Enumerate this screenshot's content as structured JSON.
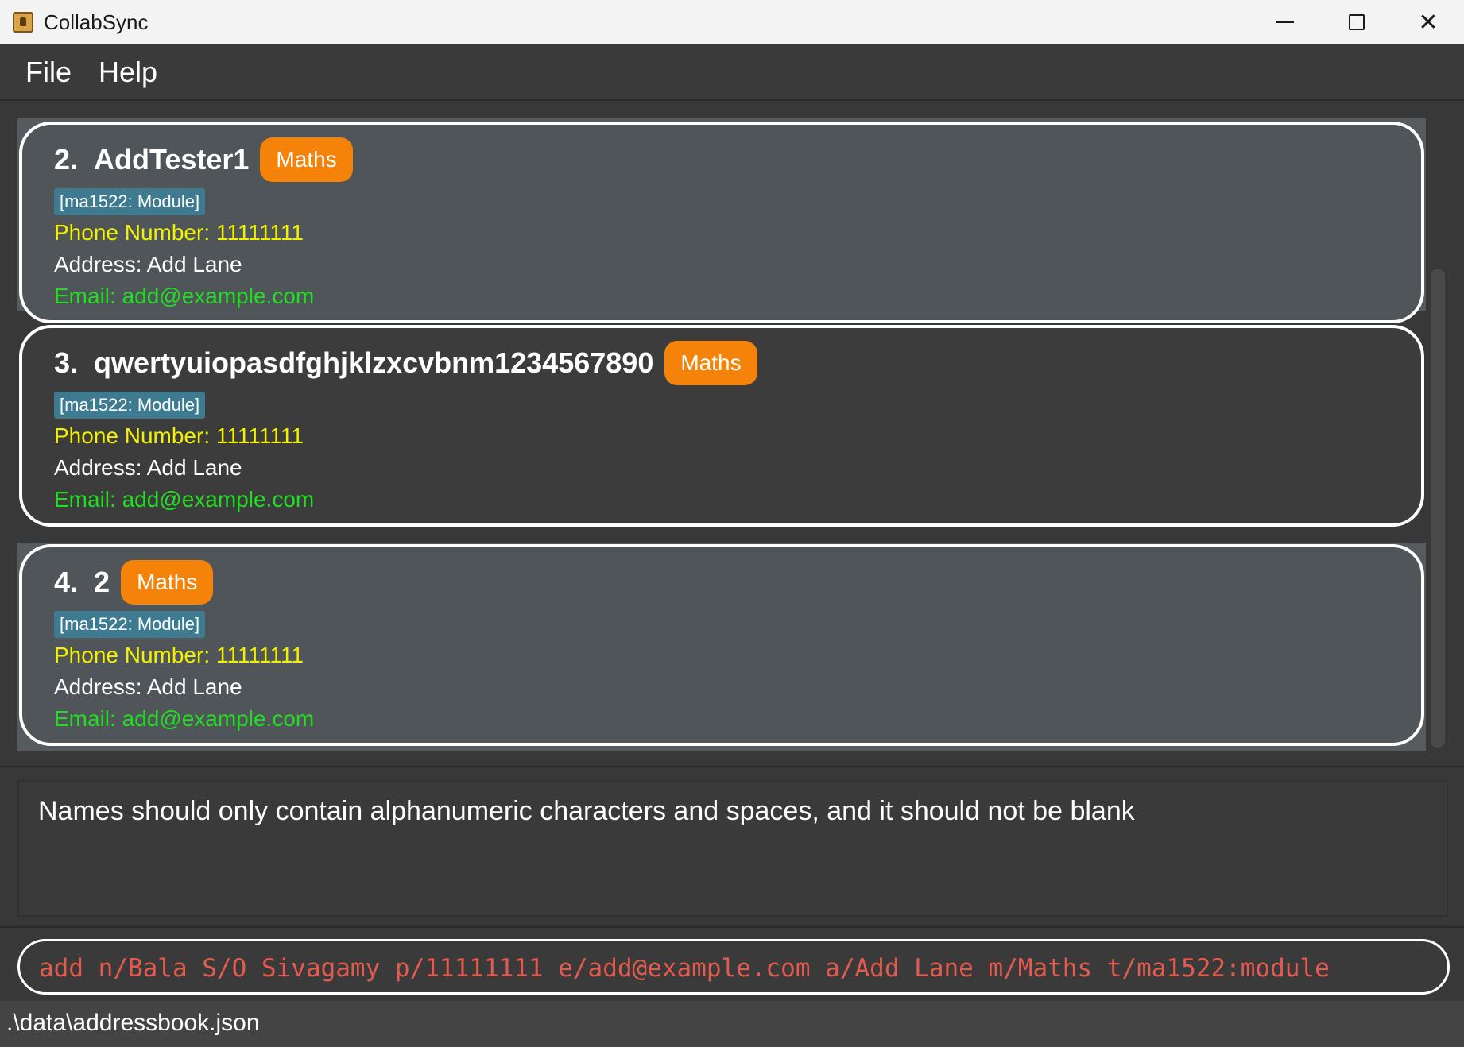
{
  "window": {
    "title": "CollabSync",
    "minimize_glyph": "",
    "close_glyph": "✕"
  },
  "menu": {
    "items": [
      {
        "label": "File"
      },
      {
        "label": "Help"
      }
    ]
  },
  "persons": [
    {
      "index": "2.",
      "name": "AddTester1",
      "badge": "Maths",
      "tag": "[ma1522: Module]",
      "phone": "Phone Number: 11111111",
      "address": "Address: Add Lane",
      "email": "Email: add@example.com"
    },
    {
      "index": "3.",
      "name": "qwertyuiopasdfghjklzxcvbnm1234567890",
      "badge": "Maths",
      "tag": "[ma1522: Module]",
      "phone": "Phone Number: 11111111",
      "address": "Address: Add Lane",
      "email": "Email: add@example.com"
    },
    {
      "index": "4.",
      "name": "2",
      "badge": "Maths",
      "tag": "[ma1522: Module]",
      "phone": "Phone Number: 11111111",
      "address": "Address: Add Lane",
      "email": "Email: add@example.com"
    }
  ],
  "result": {
    "message": "Names should only contain alphanumeric characters and spaces, and it should not be blank"
  },
  "command": {
    "value": "add n/Bala S/O Sivagamy p/11111111 e/add@example.com a/Add Lane m/Maths t/ma1522:module"
  },
  "status": {
    "file_path": ".\\data\\addressbook.json"
  },
  "colors": {
    "badge": "#f5830a",
    "tag": "#3e7b91",
    "phone": "#f2f200",
    "email": "#22dd22",
    "command_text": "#e35b4f"
  }
}
